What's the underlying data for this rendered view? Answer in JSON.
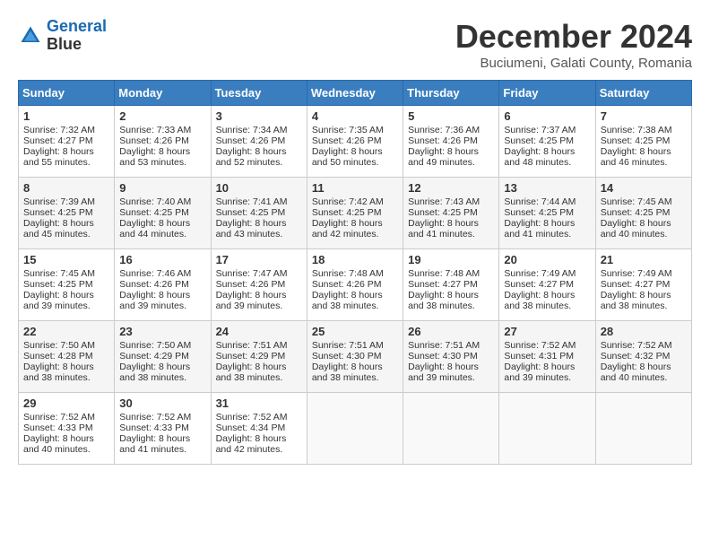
{
  "header": {
    "logo_line1": "General",
    "logo_line2": "Blue",
    "month": "December 2024",
    "location": "Buciumeni, Galati County, Romania"
  },
  "weekdays": [
    "Sunday",
    "Monday",
    "Tuesday",
    "Wednesday",
    "Thursday",
    "Friday",
    "Saturday"
  ],
  "weeks": [
    [
      {
        "day": "1",
        "sunrise": "Sunrise: 7:32 AM",
        "sunset": "Sunset: 4:27 PM",
        "daylight": "Daylight: 8 hours and 55 minutes."
      },
      {
        "day": "2",
        "sunrise": "Sunrise: 7:33 AM",
        "sunset": "Sunset: 4:26 PM",
        "daylight": "Daylight: 8 hours and 53 minutes."
      },
      {
        "day": "3",
        "sunrise": "Sunrise: 7:34 AM",
        "sunset": "Sunset: 4:26 PM",
        "daylight": "Daylight: 8 hours and 52 minutes."
      },
      {
        "day": "4",
        "sunrise": "Sunrise: 7:35 AM",
        "sunset": "Sunset: 4:26 PM",
        "daylight": "Daylight: 8 hours and 50 minutes."
      },
      {
        "day": "5",
        "sunrise": "Sunrise: 7:36 AM",
        "sunset": "Sunset: 4:26 PM",
        "daylight": "Daylight: 8 hours and 49 minutes."
      },
      {
        "day": "6",
        "sunrise": "Sunrise: 7:37 AM",
        "sunset": "Sunset: 4:25 PM",
        "daylight": "Daylight: 8 hours and 48 minutes."
      },
      {
        "day": "7",
        "sunrise": "Sunrise: 7:38 AM",
        "sunset": "Sunset: 4:25 PM",
        "daylight": "Daylight: 8 hours and 46 minutes."
      }
    ],
    [
      {
        "day": "8",
        "sunrise": "Sunrise: 7:39 AM",
        "sunset": "Sunset: 4:25 PM",
        "daylight": "Daylight: 8 hours and 45 minutes."
      },
      {
        "day": "9",
        "sunrise": "Sunrise: 7:40 AM",
        "sunset": "Sunset: 4:25 PM",
        "daylight": "Daylight: 8 hours and 44 minutes."
      },
      {
        "day": "10",
        "sunrise": "Sunrise: 7:41 AM",
        "sunset": "Sunset: 4:25 PM",
        "daylight": "Daylight: 8 hours and 43 minutes."
      },
      {
        "day": "11",
        "sunrise": "Sunrise: 7:42 AM",
        "sunset": "Sunset: 4:25 PM",
        "daylight": "Daylight: 8 hours and 42 minutes."
      },
      {
        "day": "12",
        "sunrise": "Sunrise: 7:43 AM",
        "sunset": "Sunset: 4:25 PM",
        "daylight": "Daylight: 8 hours and 41 minutes."
      },
      {
        "day": "13",
        "sunrise": "Sunrise: 7:44 AM",
        "sunset": "Sunset: 4:25 PM",
        "daylight": "Daylight: 8 hours and 41 minutes."
      },
      {
        "day": "14",
        "sunrise": "Sunrise: 7:45 AM",
        "sunset": "Sunset: 4:25 PM",
        "daylight": "Daylight: 8 hours and 40 minutes."
      }
    ],
    [
      {
        "day": "15",
        "sunrise": "Sunrise: 7:45 AM",
        "sunset": "Sunset: 4:25 PM",
        "daylight": "Daylight: 8 hours and 39 minutes."
      },
      {
        "day": "16",
        "sunrise": "Sunrise: 7:46 AM",
        "sunset": "Sunset: 4:26 PM",
        "daylight": "Daylight: 8 hours and 39 minutes."
      },
      {
        "day": "17",
        "sunrise": "Sunrise: 7:47 AM",
        "sunset": "Sunset: 4:26 PM",
        "daylight": "Daylight: 8 hours and 39 minutes."
      },
      {
        "day": "18",
        "sunrise": "Sunrise: 7:48 AM",
        "sunset": "Sunset: 4:26 PM",
        "daylight": "Daylight: 8 hours and 38 minutes."
      },
      {
        "day": "19",
        "sunrise": "Sunrise: 7:48 AM",
        "sunset": "Sunset: 4:27 PM",
        "daylight": "Daylight: 8 hours and 38 minutes."
      },
      {
        "day": "20",
        "sunrise": "Sunrise: 7:49 AM",
        "sunset": "Sunset: 4:27 PM",
        "daylight": "Daylight: 8 hours and 38 minutes."
      },
      {
        "day": "21",
        "sunrise": "Sunrise: 7:49 AM",
        "sunset": "Sunset: 4:27 PM",
        "daylight": "Daylight: 8 hours and 38 minutes."
      }
    ],
    [
      {
        "day": "22",
        "sunrise": "Sunrise: 7:50 AM",
        "sunset": "Sunset: 4:28 PM",
        "daylight": "Daylight: 8 hours and 38 minutes."
      },
      {
        "day": "23",
        "sunrise": "Sunrise: 7:50 AM",
        "sunset": "Sunset: 4:29 PM",
        "daylight": "Daylight: 8 hours and 38 minutes."
      },
      {
        "day": "24",
        "sunrise": "Sunrise: 7:51 AM",
        "sunset": "Sunset: 4:29 PM",
        "daylight": "Daylight: 8 hours and 38 minutes."
      },
      {
        "day": "25",
        "sunrise": "Sunrise: 7:51 AM",
        "sunset": "Sunset: 4:30 PM",
        "daylight": "Daylight: 8 hours and 38 minutes."
      },
      {
        "day": "26",
        "sunrise": "Sunrise: 7:51 AM",
        "sunset": "Sunset: 4:30 PM",
        "daylight": "Daylight: 8 hours and 39 minutes."
      },
      {
        "day": "27",
        "sunrise": "Sunrise: 7:52 AM",
        "sunset": "Sunset: 4:31 PM",
        "daylight": "Daylight: 8 hours and 39 minutes."
      },
      {
        "day": "28",
        "sunrise": "Sunrise: 7:52 AM",
        "sunset": "Sunset: 4:32 PM",
        "daylight": "Daylight: 8 hours and 40 minutes."
      }
    ],
    [
      {
        "day": "29",
        "sunrise": "Sunrise: 7:52 AM",
        "sunset": "Sunset: 4:33 PM",
        "daylight": "Daylight: 8 hours and 40 minutes."
      },
      {
        "day": "30",
        "sunrise": "Sunrise: 7:52 AM",
        "sunset": "Sunset: 4:33 PM",
        "daylight": "Daylight: 8 hours and 41 minutes."
      },
      {
        "day": "31",
        "sunrise": "Sunrise: 7:52 AM",
        "sunset": "Sunset: 4:34 PM",
        "daylight": "Daylight: 8 hours and 42 minutes."
      },
      null,
      null,
      null,
      null
    ]
  ]
}
